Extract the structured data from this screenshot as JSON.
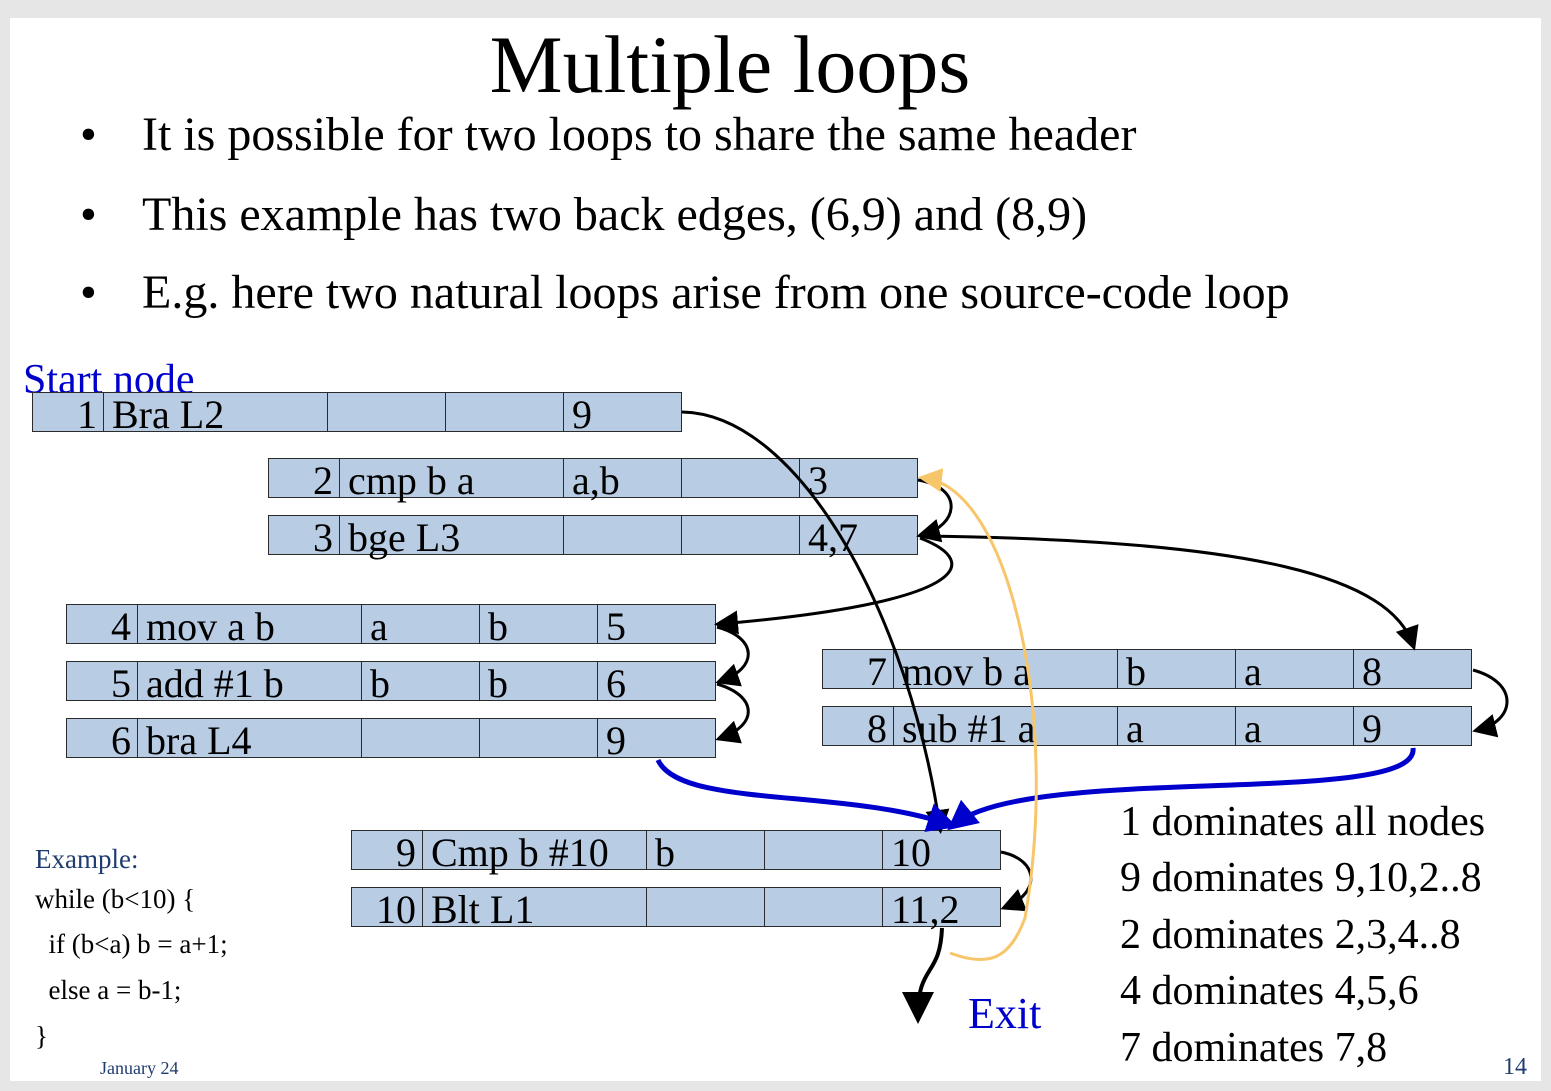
{
  "title": "Multiple loops",
  "bullets": [
    "It is possible for two loops to share the same header",
    "This example has two back edges, (6,9) and (8,9)",
    "E.g. here two natural loops arise from one source-code loop"
  ],
  "bullet_symbol": "•",
  "start_label": "Start node",
  "exit_label": "Exit",
  "nodes": [
    {
      "id": "1",
      "instr": "Bra L2",
      "use": "",
      "def": "",
      "succ": "9"
    },
    {
      "id": "2",
      "instr": "cmp b a",
      "use": "a,b",
      "def": "",
      "succ": "3"
    },
    {
      "id": "3",
      "instr": "bge L3",
      "use": "",
      "def": "",
      "succ": "4,7"
    },
    {
      "id": "4",
      "instr": "mov a b",
      "use": "a",
      "def": "b",
      "succ": "5"
    },
    {
      "id": "5",
      "instr": "add #1 b",
      "use": "b",
      "def": "b",
      "succ": "6"
    },
    {
      "id": "6",
      "instr": "bra L4",
      "use": "",
      "def": "",
      "succ": "9"
    },
    {
      "id": "7",
      "instr": "mov b a",
      "use": "b",
      "def": "a",
      "succ": "8"
    },
    {
      "id": "8",
      "instr": "sub #1 a",
      "use": "a",
      "def": "a",
      "succ": "9"
    },
    {
      "id": "9",
      "instr": "Cmp b #10",
      "use": "b",
      "def": "",
      "succ": "10"
    },
    {
      "id": "10",
      "instr": "Blt L1",
      "use": "",
      "def": "",
      "succ": "11,2"
    }
  ],
  "dominance": [
    "1 dominates all nodes",
    "9 dominates 9,10,2..8",
    "2 dominates 2,3,4..8",
    "4 dominates 4,5,6",
    "7 dominates 7,8"
  ],
  "example": {
    "label": "Example:",
    "lines": [
      "while (b<10) {",
      "  if (b<a) b = a+1;",
      "  else a = b-1;",
      "}"
    ]
  },
  "footer": {
    "date": "January 24",
    "page": "14"
  },
  "colors": {
    "cell_fill": "#b8cce4",
    "back_edge": "#0000cc",
    "edge_10_2": "#f8c66a",
    "edge": "#000000",
    "link_text": "#0000cc"
  }
}
